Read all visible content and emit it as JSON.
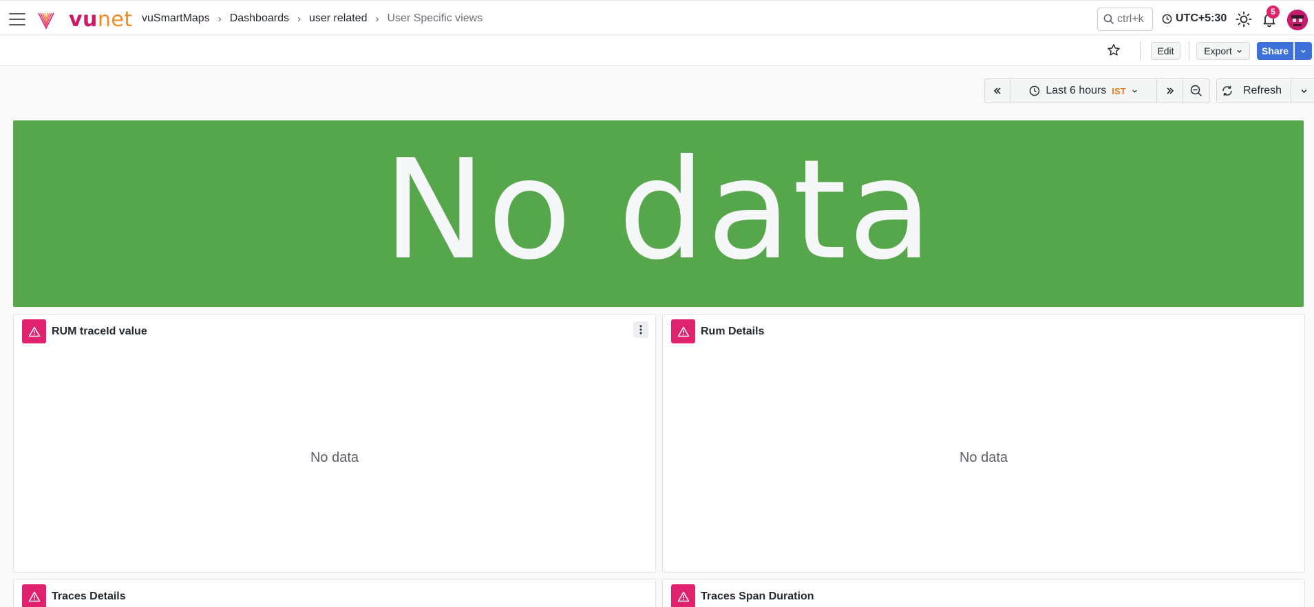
{
  "header": {
    "logo": {
      "part1": "vu",
      "part2": "net"
    },
    "breadcrumb": [
      {
        "label": "vuSmartMaps"
      },
      {
        "label": "Dashboards"
      },
      {
        "label": "user related"
      },
      {
        "label": "User Specific views"
      }
    ],
    "search_placeholder": "ctrl+k",
    "timezone": "UTC+5:30",
    "notification_count": "5"
  },
  "toolbar": {
    "edit_label": "Edit",
    "export_label": "Export",
    "share_label": "Share"
  },
  "time_controls": {
    "range_label": "Last 6 hours",
    "tz_badge": "IST",
    "refresh_label": "Refresh"
  },
  "stat_panel": {
    "value": "No data",
    "background": "#56a64b"
  },
  "panels": [
    {
      "title": "RUM traceId value",
      "message": "No data"
    },
    {
      "title": "Rum Details",
      "message": "No data"
    },
    {
      "title": "Traces Details"
    },
    {
      "title": "Traces Span Duration"
    }
  ],
  "colors": {
    "brand_pink": "#cc1a66",
    "brand_orange": "#f08a24",
    "primary_blue": "#3d71d9",
    "error_pink": "#e0226e"
  }
}
